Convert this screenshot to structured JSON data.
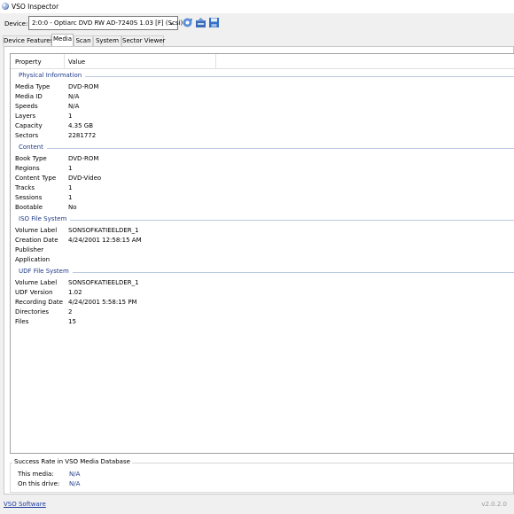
{
  "window": {
    "title": "VSO Inspector",
    "icon": "app-disc-icon"
  },
  "device": {
    "label": "Device:",
    "selected": "2:0:0 - Optiarc DVD RW AD-7240S 1.03 [F] (Scsi)",
    "toolbar_icons": [
      "refresh-icon",
      "eject-icon",
      "save-icon"
    ]
  },
  "tabs": [
    {
      "label": "Device Features",
      "active": false
    },
    {
      "label": "Media",
      "active": true
    },
    {
      "label": "Scan",
      "active": false
    },
    {
      "label": "System",
      "active": false
    },
    {
      "label": "Sector Viewer",
      "active": false
    }
  ],
  "table": {
    "columns": [
      "Property",
      "Value"
    ],
    "groups": [
      {
        "title": "Physical Information",
        "rows": [
          [
            "Media Type",
            "DVD-ROM"
          ],
          [
            "Media ID",
            "N/A"
          ],
          [
            "Speeds",
            "N/A"
          ],
          [
            "Layers",
            "1"
          ],
          [
            "Capacity",
            "4.35 GB"
          ],
          [
            "Sectors",
            "2281772"
          ]
        ]
      },
      {
        "title": "Content",
        "rows": [
          [
            "Book Type",
            "DVD-ROM"
          ],
          [
            "Regions",
            "1"
          ],
          [
            "Content Type",
            "DVD-Video"
          ],
          [
            "Tracks",
            "1"
          ],
          [
            "Sessions",
            "1"
          ],
          [
            "Bootable",
            "No"
          ]
        ]
      },
      {
        "title": "ISO File System",
        "rows": [
          [
            "Volume Label",
            "SONSOFKATIEELDER_1"
          ],
          [
            "Creation Date",
            "4/24/2001 12:58:15 AM"
          ],
          [
            "Publisher",
            ""
          ],
          [
            "Application",
            ""
          ]
        ]
      },
      {
        "title": "UDF File System",
        "rows": [
          [
            "Volume Label",
            "SONSOFKATIEELDER_1"
          ],
          [
            "UDF Version",
            "1.02"
          ],
          [
            "Recording Date",
            "4/24/2001 5:58:15 PM"
          ],
          [
            "Directories",
            "2"
          ],
          [
            "Files",
            "15"
          ]
        ]
      }
    ]
  },
  "success_rate": {
    "title": "Success Rate in VSO Media Database",
    "this_media_label": "This media:",
    "this_media_value": "N/A",
    "this_drive_label": "On this drive:",
    "this_drive_value": "N/A"
  },
  "footer": {
    "link": "VSO Software",
    "version": "v2.0.2.0"
  },
  "colors": {
    "group_title": "#1e3a8a",
    "link": "#1e3aa0",
    "accent_blue": "#2f6fd6"
  }
}
